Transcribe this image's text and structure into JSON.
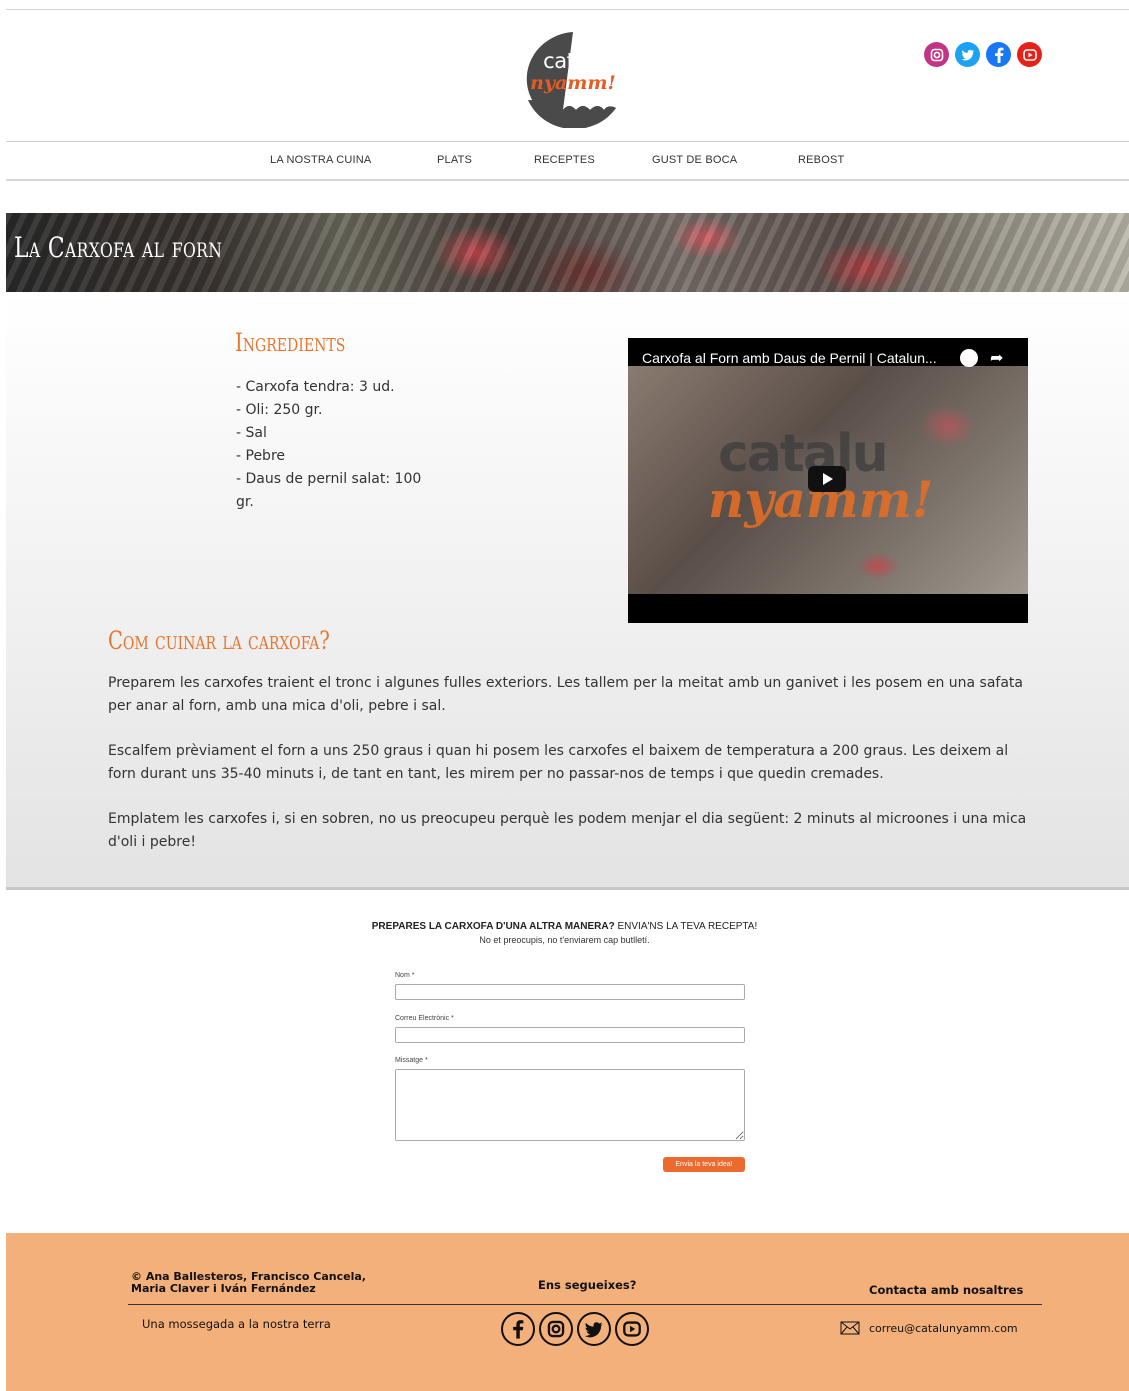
{
  "logo": {
    "line1": "catalu",
    "line2": "nyamm!"
  },
  "social_icons": [
    "instagram-icon",
    "twitter-icon",
    "facebook-icon",
    "youtube-icon"
  ],
  "nav": {
    "items": [
      "LA NOSTRA CUINA",
      "PLATS",
      "RECEPTES",
      "GUST DE BOCA",
      "REBOST"
    ]
  },
  "hero": {
    "title": "La Carxofa al forn"
  },
  "ingredients": {
    "title": "Ingredients",
    "items": [
      "- Carxofa tendra: 3 ud.",
      "- Oli: 250 gr.",
      "- Sal",
      "- Pebre",
      "- Daus de pernil salat: 100 gr."
    ]
  },
  "video": {
    "title": "Carxofa al Forn amb Daus de Pernil | Catalun...",
    "logo_line1": "catalu",
    "logo_line2": "nyamm!"
  },
  "how_to": {
    "title": "Com cuinar la carxofa?",
    "paragraphs": [
      "Preparem les carxofes traient el tronc i algunes fulles exteriors. Les tallem per la meitat amb un ganivet i les posem en una safata per anar al forn, amb una mica d'oli, pebre i sal.",
      "Escalfem prèviament el forn a uns 250 graus i quan hi posem les carxofes el baixem de temperatura a 200 graus. Les deixem al forn durant uns 35-40 minuts i, de tant en tant, les mirem per no passar-nos de temps i que quedin cremades.",
      "Emplatem les carxofes i, si en sobren, no us preocupeu perquè les podem menjar el dia següent: 2 minuts al microones i una mica d'oli i pebre!"
    ]
  },
  "form": {
    "heading_bold": "PREPARES LA CARXOFA D'UNA ALTRA MANERA?",
    "heading_rest": " ENVIA'NS LA TEVA RECEPTA!",
    "subheading": "No et preocupis, no t'enviarem cap butlletí.",
    "name_label": "Nom *",
    "name_value": "",
    "email_label": "Correu Electrònic *",
    "email_value": "",
    "message_label": "Missatge *",
    "message_value": "",
    "submit_label": "Envia la teva idea!"
  },
  "footer": {
    "copyright_line1": "© Ana Ballesteros, Francisco Cancela,",
    "copyright_line2": "Maria Claver i Iván Fernández",
    "follow_title": "Ens segueixes?",
    "contact_title": "Contacta amb nosaltres",
    "slogan": "Una mossegada a la nostra terra",
    "email": "correu@catalunyamm.com",
    "social_icons": [
      "facebook-icon",
      "instagram-icon",
      "twitter-icon",
      "youtube-icon"
    ]
  },
  "colors": {
    "accent": "#e8762f",
    "footer_bg": "#f4b07b",
    "button": "#ec6a2e",
    "instagram": "#c13584",
    "twitter": "#1da1f2",
    "facebook": "#1877f2",
    "youtube": "#e62117"
  }
}
